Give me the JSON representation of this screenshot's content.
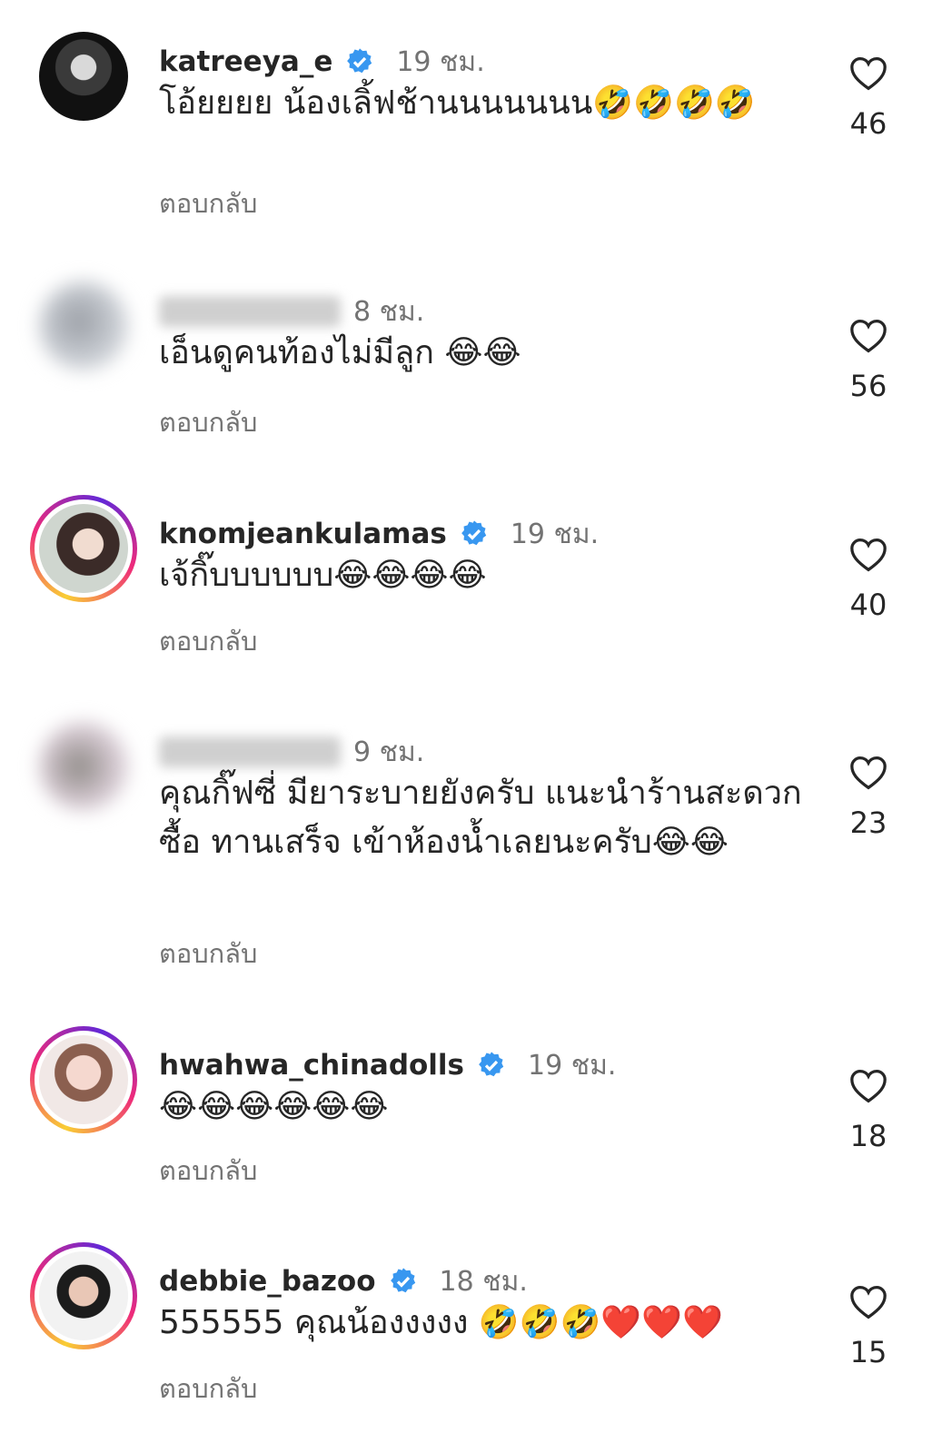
{
  "reply_label": "ตอบกลับ",
  "comments": [
    {
      "username": "katreeya_e",
      "verified": true,
      "time": "19 ชม.",
      "text": "โอ้ยยยย น้องเลิ้ฟช้านนนนนนน🤣🤣🤣🤣",
      "likes": "46"
    },
    {
      "username": "",
      "verified": false,
      "time": "8 ชม.",
      "text": "เอ็นดูคนท้องไม่มีลูก 😂😂",
      "likes": "56"
    },
    {
      "username": "knomjeankulamas",
      "verified": true,
      "time": "19 ชม.",
      "text": "เจ้กิ๊บบบบบบ😂😂😂😂",
      "likes": "40"
    },
    {
      "username": "",
      "verified": false,
      "time": "9 ชม.",
      "text": "คุณกิ๊ฟซี่ มียาระบายยังครับ แนะนำร้านสะดวกซื้อ ทานเสร็จ เข้าห้องน้ำเลยนะครับ😂😂",
      "likes": "23"
    },
    {
      "username": "hwahwa_chinadolls",
      "verified": true,
      "time": "19 ชม.",
      "text": "😂😂😂😂😂😂",
      "likes": "18"
    },
    {
      "username": "debbie_bazoo",
      "verified": true,
      "time": "18 ชม.",
      "text": "555555 คุณน้องงงงง 🤣🤣🤣❤️❤️❤️",
      "likes": "15"
    }
  ],
  "colors": {
    "verified_badge": "#3897f0",
    "secondary_text": "#737373",
    "primary_text": "#262626"
  },
  "icons": {
    "like": "heart-outline-icon",
    "verified": "verified-badge-icon"
  }
}
